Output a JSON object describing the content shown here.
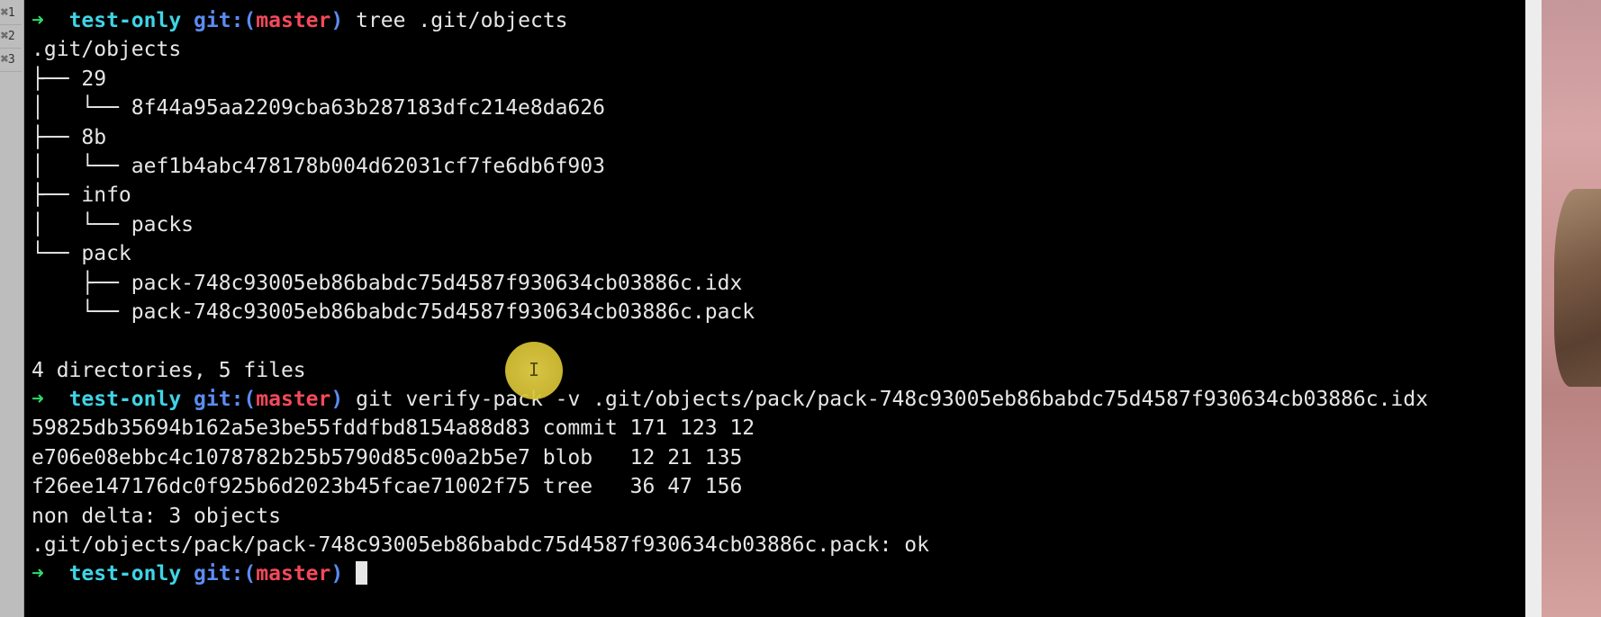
{
  "gutter": {
    "tabs": [
      "⌘1",
      "⌘2",
      "⌘3"
    ]
  },
  "terminal": {
    "prompt": {
      "arrow": "➜",
      "dir": "test-only",
      "git_prefix": "git:(",
      "branch": "master",
      "git_suffix": ")"
    },
    "commands": {
      "tree": "tree .git/objects",
      "verify": "git verify-pack -v .git/objects/pack/pack-748c93005eb86babdc75d4587f930634cb03886c.idx"
    },
    "tree_output": [
      ".git/objects",
      "├── 29",
      "│   └── 8f44a95aa2209cba63b287183dfc214e8da626",
      "├── 8b",
      "│   └── aef1b4abc478178b004d62031cf7fe6db6f903",
      "├── info",
      "│   └── packs",
      "└── pack",
      "    ├── pack-748c93005eb86babdc75d4587f930634cb03886c.idx",
      "    └── pack-748c93005eb86babdc75d4587f930634cb03886c.pack",
      "",
      "4 directories, 5 files"
    ],
    "verify_output": [
      "59825db35694b162a5e3be55fddfbd8154a88d83 commit 171 123 12",
      "e706e08ebbc4c1078782b25b5790d85c00a2b5e7 blob   12 21 135",
      "f26ee147176dc0f925b6d2023b45fcae71002f75 tree   36 47 156",
      "non delta: 3 objects",
      ".git/objects/pack/pack-748c93005eb86babdc75d4587f930634cb03886c.pack: ok"
    ]
  },
  "mouse": {
    "cursor_icon": "I"
  },
  "colors": {
    "background": "#000000",
    "text": "#e6e6e6",
    "arrow": "#2fdc6a",
    "dir": "#3fd4e6",
    "git": "#5b8cf2",
    "branch": "#f3495a",
    "mouse_highlight": "#e9d44b"
  }
}
